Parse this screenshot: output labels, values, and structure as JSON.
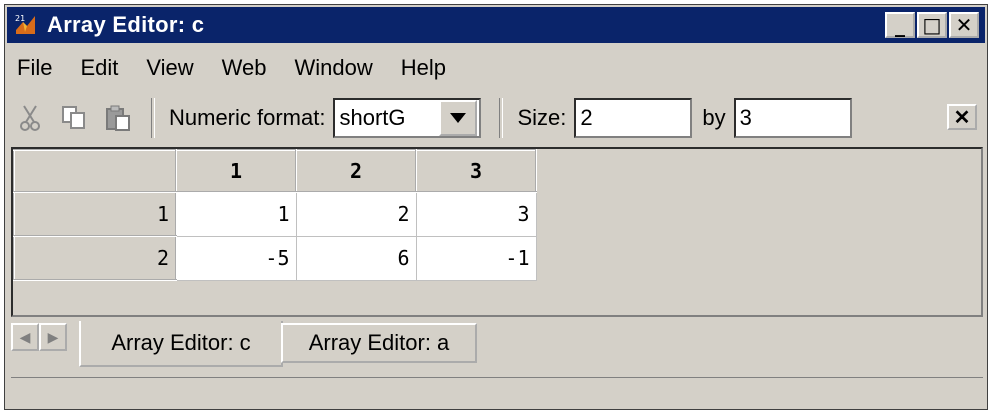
{
  "window": {
    "title": "Array Editor: c"
  },
  "window_controls": {
    "minimize": "_",
    "maximize": "□",
    "close": "✕"
  },
  "menu": [
    "File",
    "Edit",
    "View",
    "Web",
    "Window",
    "Help"
  ],
  "toolbar": {
    "numeric_format_label": "Numeric format:",
    "numeric_format_value": "shortG",
    "size_label": "Size:",
    "rows": "2",
    "by_label": "by",
    "cols": "3",
    "close_label": "✕"
  },
  "table": {
    "col_headers": [
      "1",
      "2",
      "3"
    ],
    "rows": [
      {
        "header": "1",
        "cells": [
          "1",
          "2",
          "3"
        ]
      },
      {
        "header": "2",
        "cells": [
          "-5",
          "6",
          "-1"
        ]
      }
    ]
  },
  "tabs": [
    {
      "label": "Array Editor: c",
      "active": true
    },
    {
      "label": "Array Editor: a",
      "active": false
    }
  ],
  "icons": [
    "matlab-logo-icon",
    "cut-icon",
    "copy-icon",
    "paste-icon",
    "dropdown-arrow-icon",
    "scroll-left-icon",
    "scroll-right-icon"
  ]
}
